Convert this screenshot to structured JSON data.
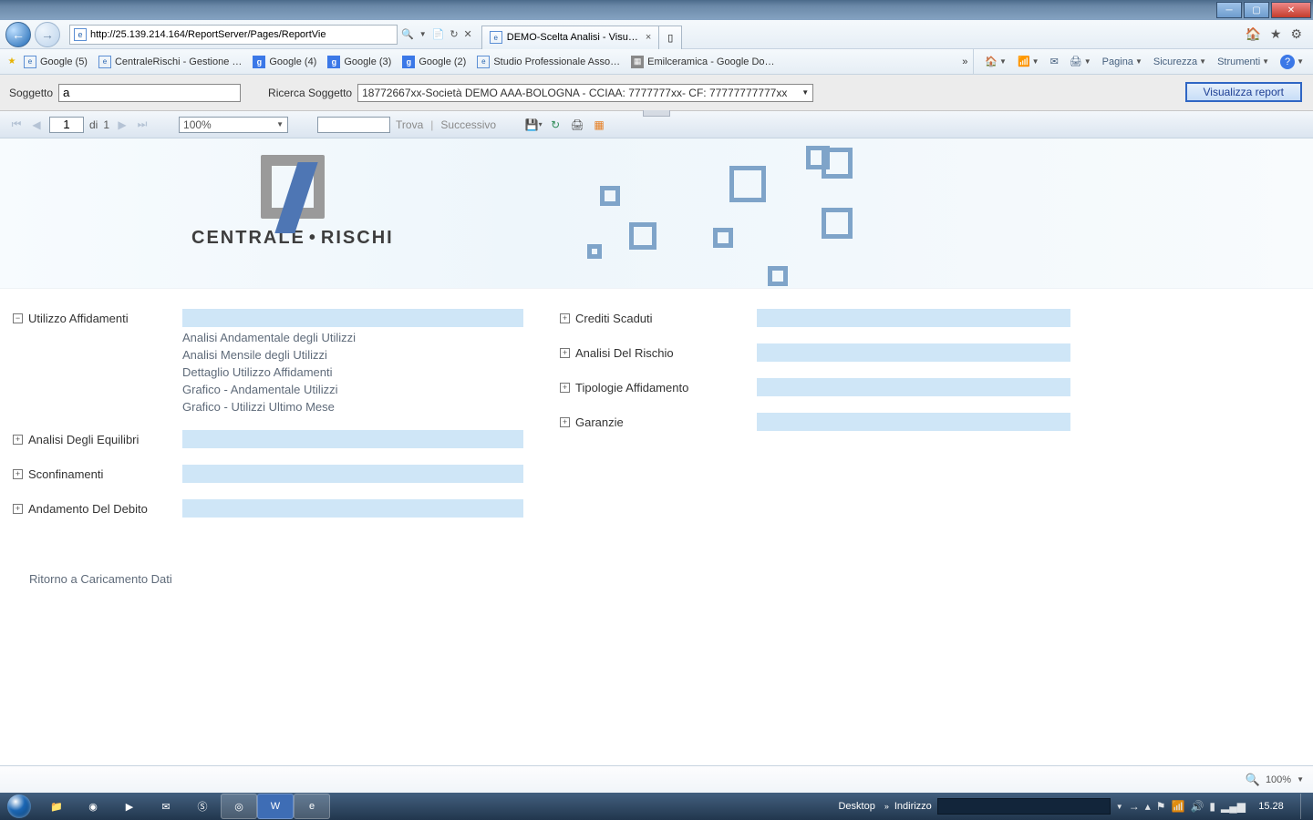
{
  "window": {
    "title": "DEMO-Scelta Analisi - Visu…"
  },
  "nav": {
    "url": "http://25.139.214.164/ReportServer/Pages/ReportVie",
    "search_placeholder": "",
    "tab_title": "DEMO-Scelta Analisi - Visu…"
  },
  "favorites": {
    "items": [
      {
        "label": "Google (5)",
        "icon": "ie"
      },
      {
        "label": "CentraleRischi - Gestione …",
        "icon": "ie"
      },
      {
        "label": "Google (4)",
        "icon": "g"
      },
      {
        "label": "Google (3)",
        "icon": "g"
      },
      {
        "label": "Google (2)",
        "icon": "g"
      },
      {
        "label": "Studio Professionale Asso…",
        "icon": "ie"
      },
      {
        "label": "Emilceramica - Google Do…",
        "icon": "doc"
      }
    ]
  },
  "cmdbar": {
    "home": "",
    "feeds": "",
    "mail": "",
    "print": "",
    "pagina": "Pagina",
    "sicurezza": "Sicurezza",
    "strumenti": "Strumenti"
  },
  "params": {
    "soggetto_label": "Soggetto",
    "soggetto_value": "a",
    "ricerca_label": "Ricerca Soggetto",
    "ricerca_value": "18772667xx-Società DEMO AAA-BOLOGNA - CCIAA: 7777777xx- CF: 77777777777xx",
    "view_btn": "Visualizza report"
  },
  "rtoolbar": {
    "page_current": "1",
    "page_sep": "di",
    "page_total": "1",
    "zoom": "100%",
    "find": "Trova",
    "next": "Successivo"
  },
  "banner": {
    "logo_text_1": "CENTRALE",
    "logo_text_2": "RISCHI"
  },
  "report": {
    "left": [
      {
        "key": "utilizzo",
        "expanded": true,
        "label": "Utilizzo Affidamenti",
        "sublinks": [
          "Analisi Andamentale degli Utilizzi",
          "Analisi Mensile degli Utilizzi",
          "Dettaglio Utilizzo Affidamenti",
          "Grafico - Andamentale Utilizzi",
          "Grafico - Utilizzi Ultimo Mese"
        ]
      },
      {
        "key": "equilibri",
        "expanded": false,
        "label": "Analisi Degli Equilibri"
      },
      {
        "key": "sconf",
        "expanded": false,
        "label": "Sconfinamenti"
      },
      {
        "key": "debito",
        "expanded": false,
        "label": "Andamento Del Debito"
      }
    ],
    "right": [
      {
        "key": "crediti",
        "expanded": false,
        "label": "Crediti Scaduti"
      },
      {
        "key": "rischio",
        "expanded": false,
        "label": "Analisi Del Rischio"
      },
      {
        "key": "tipologie",
        "expanded": false,
        "label": "Tipologie Affidamento"
      },
      {
        "key": "garanzie",
        "expanded": false,
        "label": "Garanzie"
      }
    ],
    "return_link": "Ritorno a Caricamento Dati"
  },
  "bstatus": {
    "zoom": "100%"
  },
  "taskbar": {
    "desktop_label": "Desktop",
    "indirizzo_label": "Indirizzo",
    "clock": "15.28"
  }
}
